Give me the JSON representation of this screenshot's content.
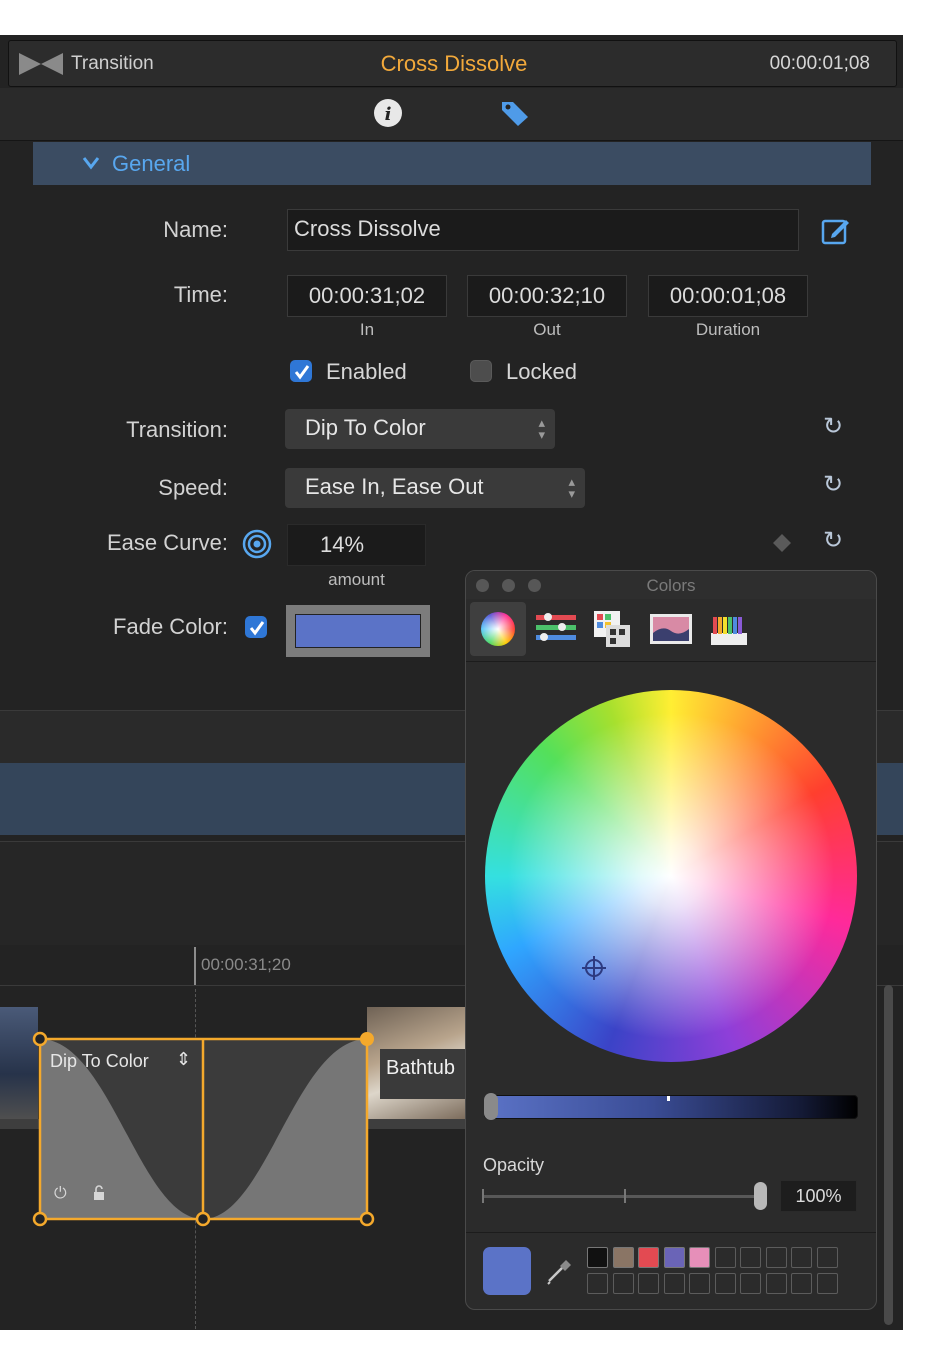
{
  "header": {
    "label": "Transition",
    "title": "Cross Dissolve",
    "timecode": "00:00:01;08"
  },
  "section": {
    "title": "General"
  },
  "fields": {
    "name_label": "Name:",
    "name_value": "Cross Dissolve",
    "time_label": "Time:",
    "time_in": "00:00:31;02",
    "time_out": "00:00:32;10",
    "time_duration": "00:00:01;08",
    "in_caption": "In",
    "out_caption": "Out",
    "duration_caption": "Duration",
    "enabled_label": "Enabled",
    "enabled_checked": true,
    "locked_label": "Locked",
    "locked_checked": false,
    "transition_label": "Transition:",
    "transition_value": "Dip To Color",
    "speed_label": "Speed:",
    "speed_value": "Ease In, Ease Out",
    "ease_label": "Ease Curve:",
    "ease_value": "14%",
    "ease_caption": "amount",
    "fade_label": "Fade Color:",
    "fade_checked": true,
    "fade_color": "#5b73c7"
  },
  "timeline": {
    "ruler_time": "00:00:31;20",
    "transition_clip_label": "Dip To Color",
    "next_clip_label": "Bathtub",
    "accent_color": "#f4a92c"
  },
  "colors_panel": {
    "title": "Colors",
    "tabs": [
      "color-wheel",
      "color-sliders",
      "color-palettes",
      "image-palettes",
      "pencils"
    ],
    "opacity_label": "Opacity",
    "opacity_value": "100%",
    "current_color": "#5b73c7",
    "saved_swatches": [
      "#111111",
      "#8a7565",
      "#e34a52",
      "#6a64b7",
      "#e68fb9"
    ]
  },
  "icons": [
    "transition-icon",
    "info-icon",
    "tag-icon",
    "edit-icon",
    "reset-icon",
    "target-icon",
    "keyframe-icon",
    "eyedropper-icon",
    "power-icon",
    "lock-icon",
    "playhead-icon"
  ]
}
